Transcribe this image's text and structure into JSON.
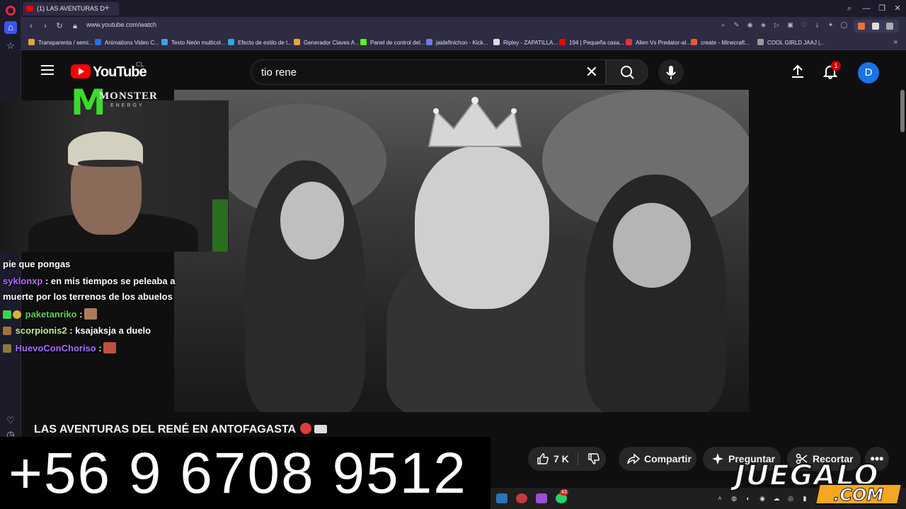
{
  "browser": {
    "tab_title": "(1) LAS AVENTURAS D",
    "url": "www.youtube.com/watch",
    "bookmarks": [
      {
        "label": "Transparenta / semi...",
        "color": "#e8a33a"
      },
      {
        "label": "Animations Video C...",
        "color": "#2f6de1"
      },
      {
        "label": "Texto Neón multicol...",
        "color": "#3aa0e8"
      },
      {
        "label": "Efecto de estilo de t...",
        "color": "#3aa0e8"
      },
      {
        "label": "Generador Claves A...",
        "color": "#e8a33a"
      },
      {
        "label": "Panel de control del...",
        "color": "#53fc18"
      },
      {
        "label": "jaidefinichon - Kick...",
        "color": "#6f7be8"
      },
      {
        "label": "Ripley - ZAPATILLA...",
        "color": "#dddddd"
      },
      {
        "label": "194 | Pequeña casa...",
        "color": "#ff0000"
      },
      {
        "label": "Alien Vs Predator-al...",
        "color": "#e8323a"
      },
      {
        "label": "create - Minecraft...",
        "color": "#e85a3a"
      },
      {
        "label": "COOL GIRLD JAAJ |...",
        "color": "#999999"
      }
    ]
  },
  "youtube": {
    "wordmark": "YouTube",
    "country": "CL",
    "search_query": "tio rene",
    "notification_count": "1",
    "avatar_letter": "D",
    "video_title": "LAS AVENTURAS DEL RENÉ EN ANTOFAGASTA",
    "like_count": "7 K",
    "share_label": "Compartir",
    "ask_label": "Preguntar",
    "clip_label": "Recortar",
    "more_label": "•••"
  },
  "stream_overlay": {
    "monster_brand": "MONSTER",
    "monster_sub": "ENERGY",
    "phone": "+56 9 6708 9512",
    "watermark_main": "JUEGALO",
    "watermark_com": ".COM",
    "chat": [
      {
        "user": "",
        "message": "pie que pongas"
      },
      {
        "user": "syklonxp",
        "message": ": en mis tiempos se peleaba a"
      },
      {
        "user": "",
        "message": "muerte por los terrenos de los abuelos"
      },
      {
        "user": "paketanriko",
        "message": ":"
      },
      {
        "user": "scorpionis2",
        "message": ": ksajaksja a duelo"
      },
      {
        "user": "HuevoConChoriso",
        "message": ":"
      }
    ]
  },
  "taskbar": {
    "badge_count": "43"
  }
}
